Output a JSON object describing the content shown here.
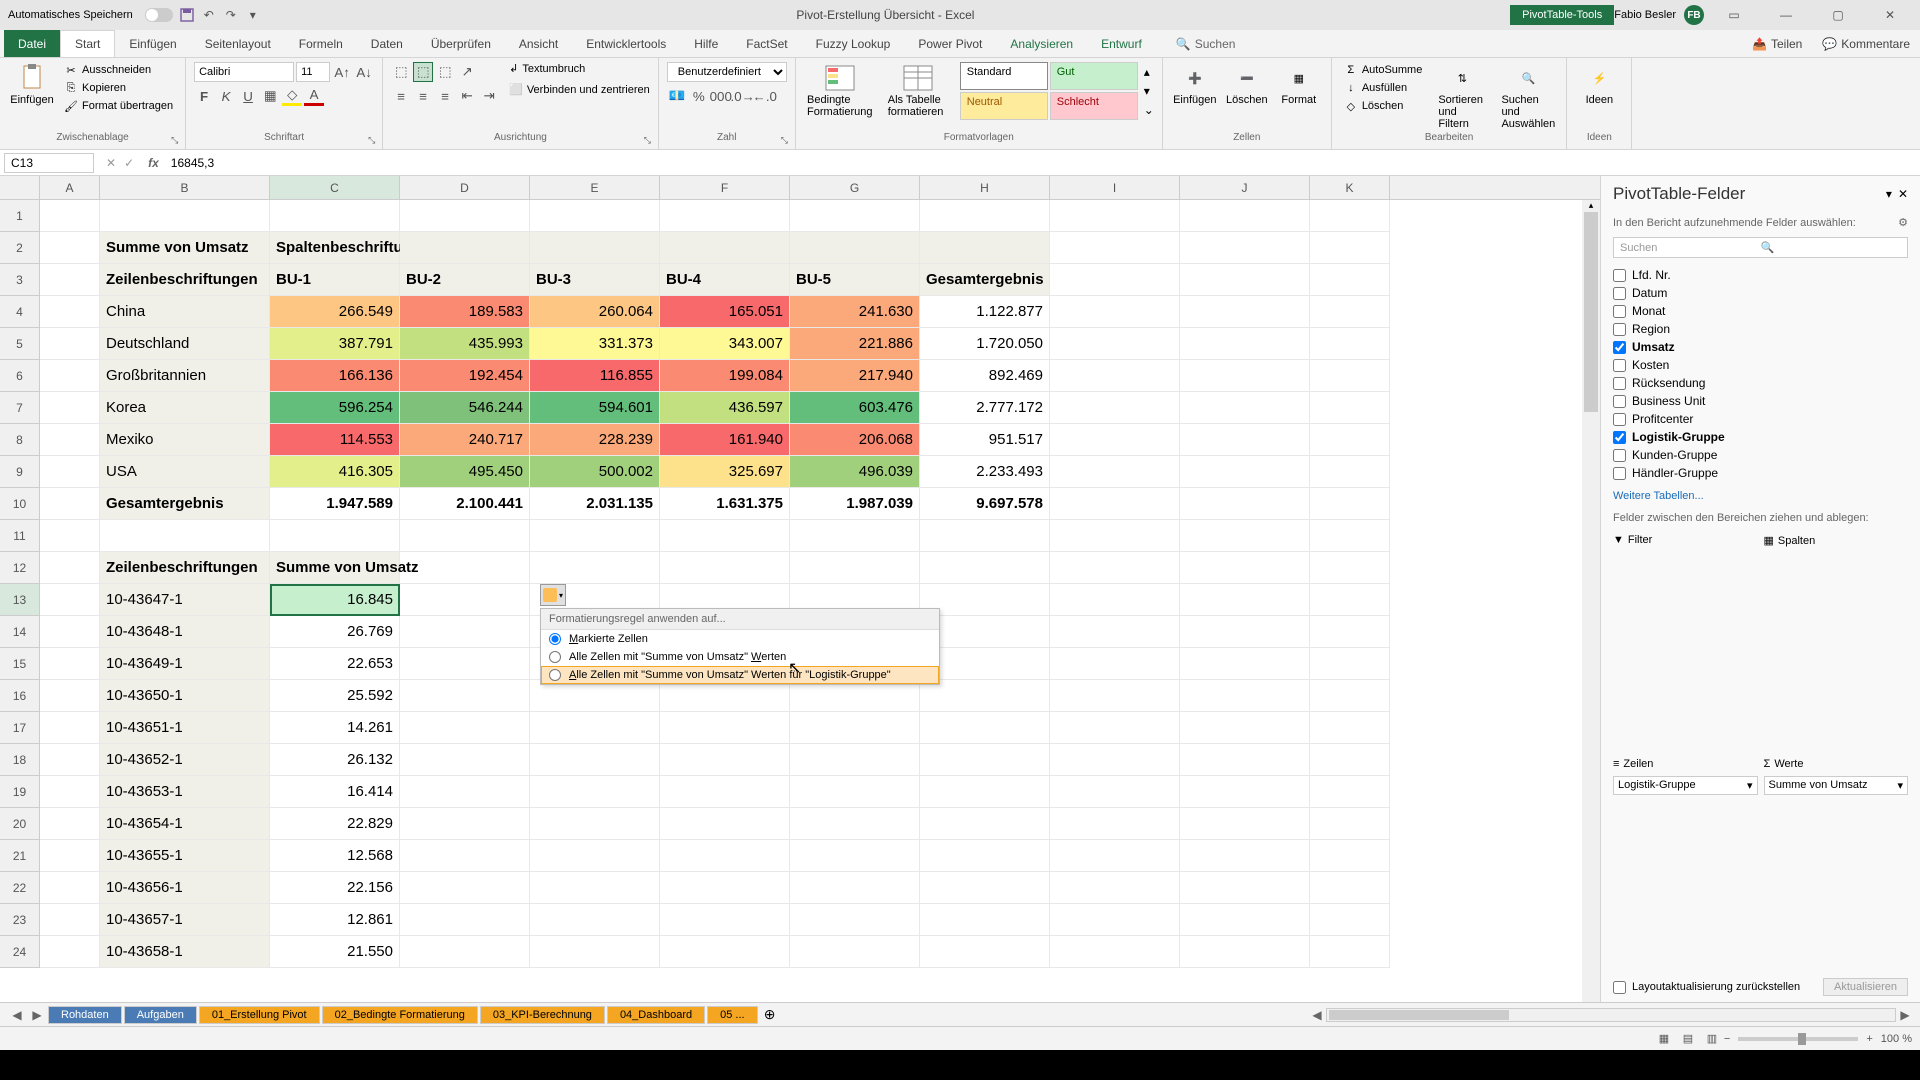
{
  "titlebar": {
    "autosave": "Automatisches Speichern",
    "title": "Pivot-Erstellung Übersicht - Excel",
    "tool_context": "PivotTable-Tools",
    "username": "Fabio Besler",
    "initials": "FB"
  },
  "ribbon_tabs": {
    "file": "Datei",
    "home": "Start",
    "insert": "Einfügen",
    "layout": "Seitenlayout",
    "formulas": "Formeln",
    "data": "Daten",
    "review": "Überprüfen",
    "view": "Ansicht",
    "developer": "Entwicklertools",
    "help": "Hilfe",
    "factset": "FactSet",
    "fuzzy": "Fuzzy Lookup",
    "powerpivot": "Power Pivot",
    "analyze": "Analysieren",
    "design": "Entwurf",
    "search": "Suchen",
    "share": "Teilen",
    "comments": "Kommentare"
  },
  "ribbon": {
    "clipboard": {
      "paste": "Einfügen",
      "cut": "Ausschneiden",
      "copy": "Kopieren",
      "format": "Format übertragen",
      "group": "Zwischenablage"
    },
    "font": {
      "name": "Calibri",
      "size": "11",
      "group": "Schriftart"
    },
    "align": {
      "wrap": "Textumbruch",
      "merge": "Verbinden und zentrieren",
      "group": "Ausrichtung"
    },
    "number": {
      "format": "Benutzerdefiniert",
      "group": "Zahl"
    },
    "styles": {
      "cond": "Bedingte Formatierung",
      "table": "Als Tabelle formatieren",
      "standard": "Standard",
      "gut": "Gut",
      "neutral": "Neutral",
      "schlecht": "Schlecht",
      "group": "Formatvorlagen"
    },
    "cells": {
      "insert": "Einfügen",
      "delete": "Löschen",
      "format": "Format",
      "group": "Zellen"
    },
    "editing": {
      "sum": "AutoSumme",
      "fill": "Ausfüllen",
      "clear": "Löschen",
      "sort": "Sortieren und Filtern",
      "find": "Suchen und Auswählen",
      "group": "Bearbeiten"
    },
    "ideas": {
      "label": "Ideen",
      "group": "Ideen"
    }
  },
  "namebox": "C13",
  "formula": "16845,3",
  "cols": [
    "A",
    "B",
    "C",
    "D",
    "E",
    "F",
    "G",
    "H",
    "I",
    "J",
    "K"
  ],
  "pivot1": {
    "title_a": "Summe von Umsatz",
    "title_b": "Spaltenbeschriftungen",
    "row_hdr": "Zeilenbeschriftungen",
    "col_hdrs": [
      "BU-1",
      "BU-2",
      "BU-3",
      "BU-4",
      "BU-5",
      "Gesamtergebnis"
    ],
    "rows": [
      {
        "label": "China",
        "vals": [
          "266.549",
          "189.583",
          "260.064",
          "165.051",
          "241.630",
          "1.122.877"
        ],
        "cf": [
          4,
          2,
          4,
          1,
          3
        ]
      },
      {
        "label": "Deutschland",
        "vals": [
          "387.791",
          "435.993",
          "331.373",
          "343.007",
          "221.886",
          "1.720.050"
        ],
        "cf": [
          7,
          8,
          6,
          6,
          3
        ]
      },
      {
        "label": "Großbritannien",
        "vals": [
          "166.136",
          "192.454",
          "116.855",
          "199.084",
          "217.940",
          "892.469"
        ],
        "cf": [
          2,
          2,
          1,
          2,
          3
        ]
      },
      {
        "label": "Korea",
        "vals": [
          "596.254",
          "546.244",
          "594.601",
          "436.597",
          "603.476",
          "2.777.172"
        ],
        "cf": [
          11,
          10,
          11,
          8,
          11
        ]
      },
      {
        "label": "Mexiko",
        "vals": [
          "114.553",
          "240.717",
          "228.239",
          "161.940",
          "206.068",
          "951.517"
        ],
        "cf": [
          1,
          3,
          3,
          1,
          2
        ]
      },
      {
        "label": "USA",
        "vals": [
          "416.305",
          "495.450",
          "500.002",
          "325.697",
          "496.039",
          "2.233.493"
        ],
        "cf": [
          7,
          9,
          9,
          5,
          9
        ]
      }
    ],
    "total_label": "Gesamtergebnis",
    "totals": [
      "1.947.589",
      "2.100.441",
      "2.031.135",
      "1.631.375",
      "1.987.039",
      "9.697.578"
    ]
  },
  "pivot2": {
    "row_hdr": "Zeilenbeschriftungen",
    "val_hdr": "Summe von Umsatz",
    "rows": [
      {
        "label": "10-43647-1",
        "val": "16.845"
      },
      {
        "label": "10-43648-1",
        "val": "26.769"
      },
      {
        "label": "10-43649-1",
        "val": "22.653"
      },
      {
        "label": "10-43650-1",
        "val": "25.592"
      },
      {
        "label": "10-43651-1",
        "val": "14.261"
      },
      {
        "label": "10-43652-1",
        "val": "26.132"
      },
      {
        "label": "10-43653-1",
        "val": "16.414"
      },
      {
        "label": "10-43654-1",
        "val": "22.829"
      },
      {
        "label": "10-43655-1",
        "val": "12.568"
      },
      {
        "label": "10-43656-1",
        "val": "22.156"
      },
      {
        "label": "10-43657-1",
        "val": "12.861"
      },
      {
        "label": "10-43658-1",
        "val": "21.550"
      }
    ]
  },
  "popup": {
    "header": "Formatierungsregel anwenden auf...",
    "opt1_a": "M",
    "opt1_b": "arkierte Zellen",
    "opt2_a": "Alle Zellen mit \"Summe von Umsatz\" ",
    "opt2_b": "W",
    "opt2_c": "erten",
    "opt3_a": "A",
    "opt3_b": "lle Zellen mit \"Summe von Umsatz\" Werten für \"Logistik-Gruppe\""
  },
  "sheets": [
    {
      "name": "Rohdaten",
      "cls": "blue"
    },
    {
      "name": "Aufgaben",
      "cls": "blue"
    },
    {
      "name": "01_Erstellung Pivot",
      "cls": "orange"
    },
    {
      "name": "02_Bedingte Formatierung",
      "cls": "orange"
    },
    {
      "name": "03_KPI-Berechnung",
      "cls": "orange"
    },
    {
      "name": "04_Dashboard",
      "cls": "orange"
    },
    {
      "name": "05 ...",
      "cls": "orange"
    }
  ],
  "status": {
    "ready": "",
    "zoom": "100 %"
  },
  "pivot_pane": {
    "title": "PivotTable-Felder",
    "subtitle": "In den Bericht aufzunehmende Felder auswählen:",
    "search": "Suchen",
    "fields": [
      {
        "name": "Lfd. Nr.",
        "checked": false
      },
      {
        "name": "Datum",
        "checked": false
      },
      {
        "name": "Monat",
        "checked": false
      },
      {
        "name": "Region",
        "checked": false
      },
      {
        "name": "Umsatz",
        "checked": true
      },
      {
        "name": "Kosten",
        "checked": false
      },
      {
        "name": "Rücksendung",
        "checked": false
      },
      {
        "name": "Business Unit",
        "checked": false
      },
      {
        "name": "Profitcenter",
        "checked": false
      },
      {
        "name": "Logistik-Gruppe",
        "checked": true
      },
      {
        "name": "Kunden-Gruppe",
        "checked": false
      },
      {
        "name": "Händler-Gruppe",
        "checked": false
      }
    ],
    "more_tables": "Weitere Tabellen...",
    "drop_hdr": "Felder zwischen den Bereichen ziehen und ablegen:",
    "zones": {
      "filters": "Filter",
      "cols": "Spalten",
      "rows": "Zeilen",
      "vals": "Werte"
    },
    "row_item": "Logistik-Gruppe",
    "val_item": "Summe von Umsatz",
    "defer": "Layoutaktualisierung zurückstellen",
    "update": "Aktualisieren"
  }
}
